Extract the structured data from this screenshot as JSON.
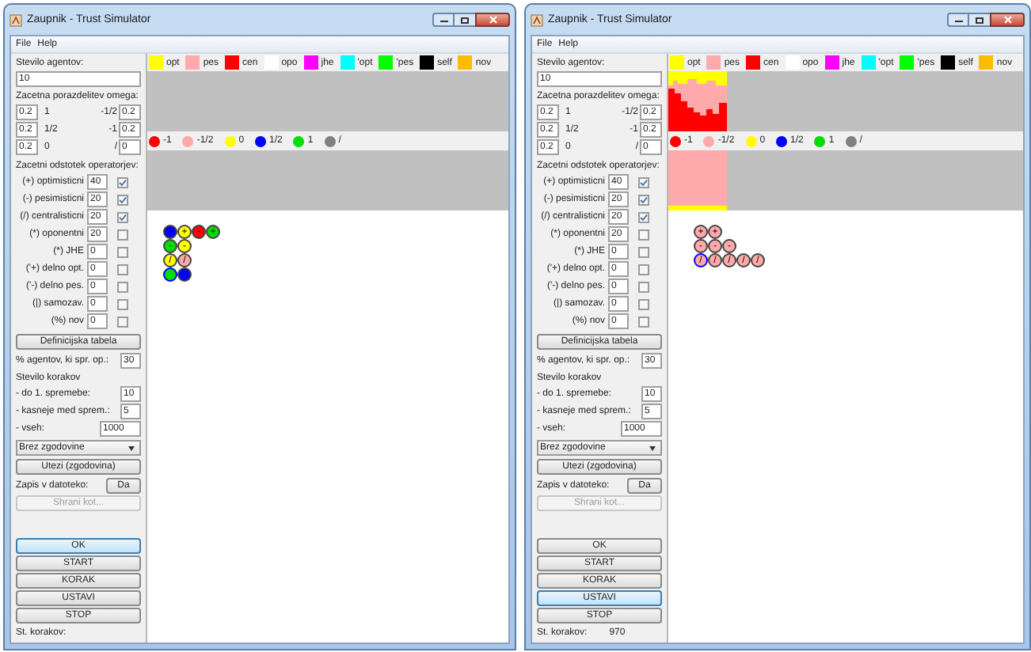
{
  "windows": [
    {
      "title": "Zaupnik - Trust Simulator",
      "menu": [
        "File",
        "Help"
      ],
      "agents_label": "Stevilo agentov:",
      "agents_value": "10",
      "omega_label": "Zacetna porazdelitev omega:",
      "omega_rows": [
        [
          "0.2",
          "1",
          "-1/2",
          "0.2"
        ],
        [
          "0.2",
          "1/2",
          "-1",
          "0.2"
        ],
        [
          "0.2",
          "0",
          "/",
          "0"
        ]
      ],
      "operators_label": "Zacetni odstotek operatorjev:",
      "operators": [
        {
          "label": "(+) optimisticni",
          "value": "40",
          "checked": true
        },
        {
          "label": "(-) pesimisticni",
          "value": "20",
          "checked": true
        },
        {
          "label": "(/) centralisticni",
          "value": "20",
          "checked": true
        },
        {
          "label": "(*) oponentni",
          "value": "20",
          "checked": false
        },
        {
          "label": "(*) JHE",
          "value": "0",
          "checked": false
        },
        {
          "label": "('+) delno opt.",
          "value": "0",
          "checked": false
        },
        {
          "label": "('-) delno pes.",
          "value": "0",
          "checked": false
        },
        {
          "label": "(|) samozav.",
          "value": "0",
          "checked": false
        },
        {
          "label": "(%) nov",
          "value": "0",
          "checked": false
        }
      ],
      "table_button": "Definicijska tabela",
      "percent_label": "% agentov, ki spr. op.:",
      "percent_value": "30",
      "steps_label": "Stevilo korakov",
      "steps": [
        {
          "label": "- do 1. spremebe:",
          "value": "10"
        },
        {
          "label": "- kasneje med sprem.:",
          "value": "5"
        },
        {
          "label": "- vseh:",
          "value": "1000"
        }
      ],
      "history_select": "Brez zgodovine",
      "weights_button": "Utezi (zgodovina)",
      "file_label": "Zapis v datoteko:",
      "file_button": "Da",
      "save_button": {
        "label": "Shrani kot...",
        "disabled": true
      },
      "controls": [
        {
          "label": "OK",
          "focused": true
        },
        {
          "label": "START",
          "focused": false
        },
        {
          "label": "KORAK",
          "focused": false
        },
        {
          "label": "USTAVI",
          "focused": false
        },
        {
          "label": "STOP",
          "focused": false
        }
      ],
      "step_count_label": "St. korakov:",
      "legend_operators": [
        {
          "label": "opt",
          "color": "#ffff00"
        },
        {
          "label": "pes",
          "color": "#ffaaaa"
        },
        {
          "label": "cen",
          "color": "#ff0000"
        },
        {
          "label": "opo",
          "color": "#ffffff"
        },
        {
          "label": "jhe",
          "color": "#ff00ff"
        },
        {
          "label": "'opt",
          "color": "#00ffff"
        },
        {
          "label": "'pes",
          "color": "#00ff00"
        },
        {
          "label": "self",
          "color": "#000000"
        },
        {
          "label": "nov",
          "color": "#ffbb00"
        }
      ],
      "legend_values": [
        {
          "label": "-1",
          "color": "#ff0000"
        },
        {
          "label": "-1/2",
          "color": "#ffaaaa"
        },
        {
          "label": "0",
          "color": "#ffff00"
        },
        {
          "label": "1/2",
          "color": "#0000ff"
        },
        {
          "label": "1",
          "color": "#00dd00"
        },
        {
          "label": "/",
          "color": "#808080"
        }
      ],
      "history_plot": false,
      "agents": [
        [
          {
            "color": "#0000ff",
            "ringed": false,
            "symbol": "-"
          },
          {
            "color": "#ffff00",
            "ringed": false,
            "symbol": "+"
          },
          {
            "color": "#ff0000",
            "ringed": false,
            "symbol": "-"
          },
          {
            "color": "#00dd00",
            "ringed": false,
            "symbol": "+"
          }
        ],
        [
          {
            "color": "#00dd00",
            "ringed": false,
            "symbol": "-"
          },
          {
            "color": "#ffff00",
            "ringed": false,
            "symbol": "-"
          }
        ],
        [
          {
            "color": "#ffff00",
            "ringed": false,
            "symbol": "/"
          },
          {
            "color": "#ffaaaa",
            "ringed": false,
            "symbol": "/"
          }
        ],
        [
          {
            "color": "#00dd00",
            "ringed": true
          },
          {
            "color": "#0000ff",
            "ringed": false
          }
        ]
      ]
    },
    {
      "title": "Zaupnik - Trust Simulator",
      "menu": [
        "File",
        "Help"
      ],
      "agents_label": "Stevilo agentov:",
      "agents_value": "10",
      "omega_label": "Zacetna porazdelitev omega:",
      "omega_rows": [
        [
          "0.2",
          "1",
          "-1/2",
          "0.2"
        ],
        [
          "0.2",
          "1/2",
          "-1",
          "0.2"
        ],
        [
          "0.2",
          "0",
          "/",
          "0"
        ]
      ],
      "operators_label": "Zacetni odstotek operatorjev:",
      "operators": [
        {
          "label": "(+) optimisticni",
          "value": "40",
          "checked": true
        },
        {
          "label": "(-) pesimisticni",
          "value": "20",
          "checked": true
        },
        {
          "label": "(/) centralisticni",
          "value": "20",
          "checked": true
        },
        {
          "label": "(*) oponentni",
          "value": "20",
          "checked": false
        },
        {
          "label": "(*) JHE",
          "value": "0",
          "checked": false
        },
        {
          "label": "('+) delno opt.",
          "value": "0",
          "checked": false
        },
        {
          "label": "('-) delno pes.",
          "value": "0",
          "checked": false
        },
        {
          "label": "(|) samozav.",
          "value": "0",
          "checked": false
        },
        {
          "label": "(%) nov",
          "value": "0",
          "checked": false
        }
      ],
      "table_button": "Definicijska tabela",
      "percent_label": "% agentov, ki spr. op.:",
      "percent_value": "30",
      "steps_label": "Stevilo korakov",
      "steps": [
        {
          "label": "- do 1. spremebe:",
          "value": "10"
        },
        {
          "label": "- kasneje med sprem.:",
          "value": "5"
        },
        {
          "label": "- vseh:",
          "value": "1000"
        }
      ],
      "history_select": "Brez zgodovine",
      "weights_button": "Utezi (zgodovina)",
      "file_label": "Zapis v datoteko:",
      "file_button": "Da",
      "save_button": {
        "label": "Shrani kot...",
        "disabled": true
      },
      "controls": [
        {
          "label": "OK",
          "focused": false
        },
        {
          "label": "START",
          "focused": false
        },
        {
          "label": "KORAK",
          "focused": false
        },
        {
          "label": "USTAVI",
          "focused": true
        },
        {
          "label": "STOP",
          "focused": false
        }
      ],
      "step_count_label": "St. korakov:",
      "step_count": "970",
      "legend_operators": [
        {
          "label": "opt",
          "color": "#ffff00"
        },
        {
          "label": "pes",
          "color": "#ffaaaa"
        },
        {
          "label": "cen",
          "color": "#ff0000"
        },
        {
          "label": "opo",
          "color": "#ffffff"
        },
        {
          "label": "jhe",
          "color": "#ff00ff"
        },
        {
          "label": "'opt",
          "color": "#00ffff"
        },
        {
          "label": "'pes",
          "color": "#00ff00"
        },
        {
          "label": "self",
          "color": "#000000"
        },
        {
          "label": "nov",
          "color": "#ffbb00"
        }
      ],
      "legend_values": [
        {
          "label": "-1",
          "color": "#ff0000"
        },
        {
          "label": "-1/2",
          "color": "#ffaaaa"
        },
        {
          "label": "0",
          "color": "#ffff00"
        },
        {
          "label": "1/2",
          "color": "#0000ff"
        },
        {
          "label": "1",
          "color": "#00dd00"
        },
        {
          "label": "/",
          "color": "#808080"
        }
      ],
      "history_plot": true,
      "agents": [
        [
          {
            "color": "#ffaaaa",
            "ringed": false,
            "symbol": "+"
          },
          {
            "color": "#ffaaaa",
            "ringed": false,
            "symbol": "+"
          }
        ],
        [
          {
            "color": "#ffaaaa",
            "ringed": false,
            "symbol": "-"
          },
          {
            "color": "#ffaaaa",
            "ringed": false,
            "symbol": "-"
          },
          {
            "color": "#ffaaaa",
            "ringed": false,
            "symbol": "-"
          }
        ],
        [
          {
            "color": "#ffaaaa",
            "ringed": true,
            "symbol": "/"
          },
          {
            "color": "#ffaaaa",
            "ringed": false,
            "symbol": "/"
          },
          {
            "color": "#ffaaaa",
            "ringed": false,
            "symbol": "/"
          },
          {
            "color": "#ffaaaa",
            "ringed": false,
            "symbol": "/"
          },
          {
            "color": "#ffaaaa",
            "ringed": false,
            "symbol": "/"
          }
        ]
      ]
    }
  ]
}
